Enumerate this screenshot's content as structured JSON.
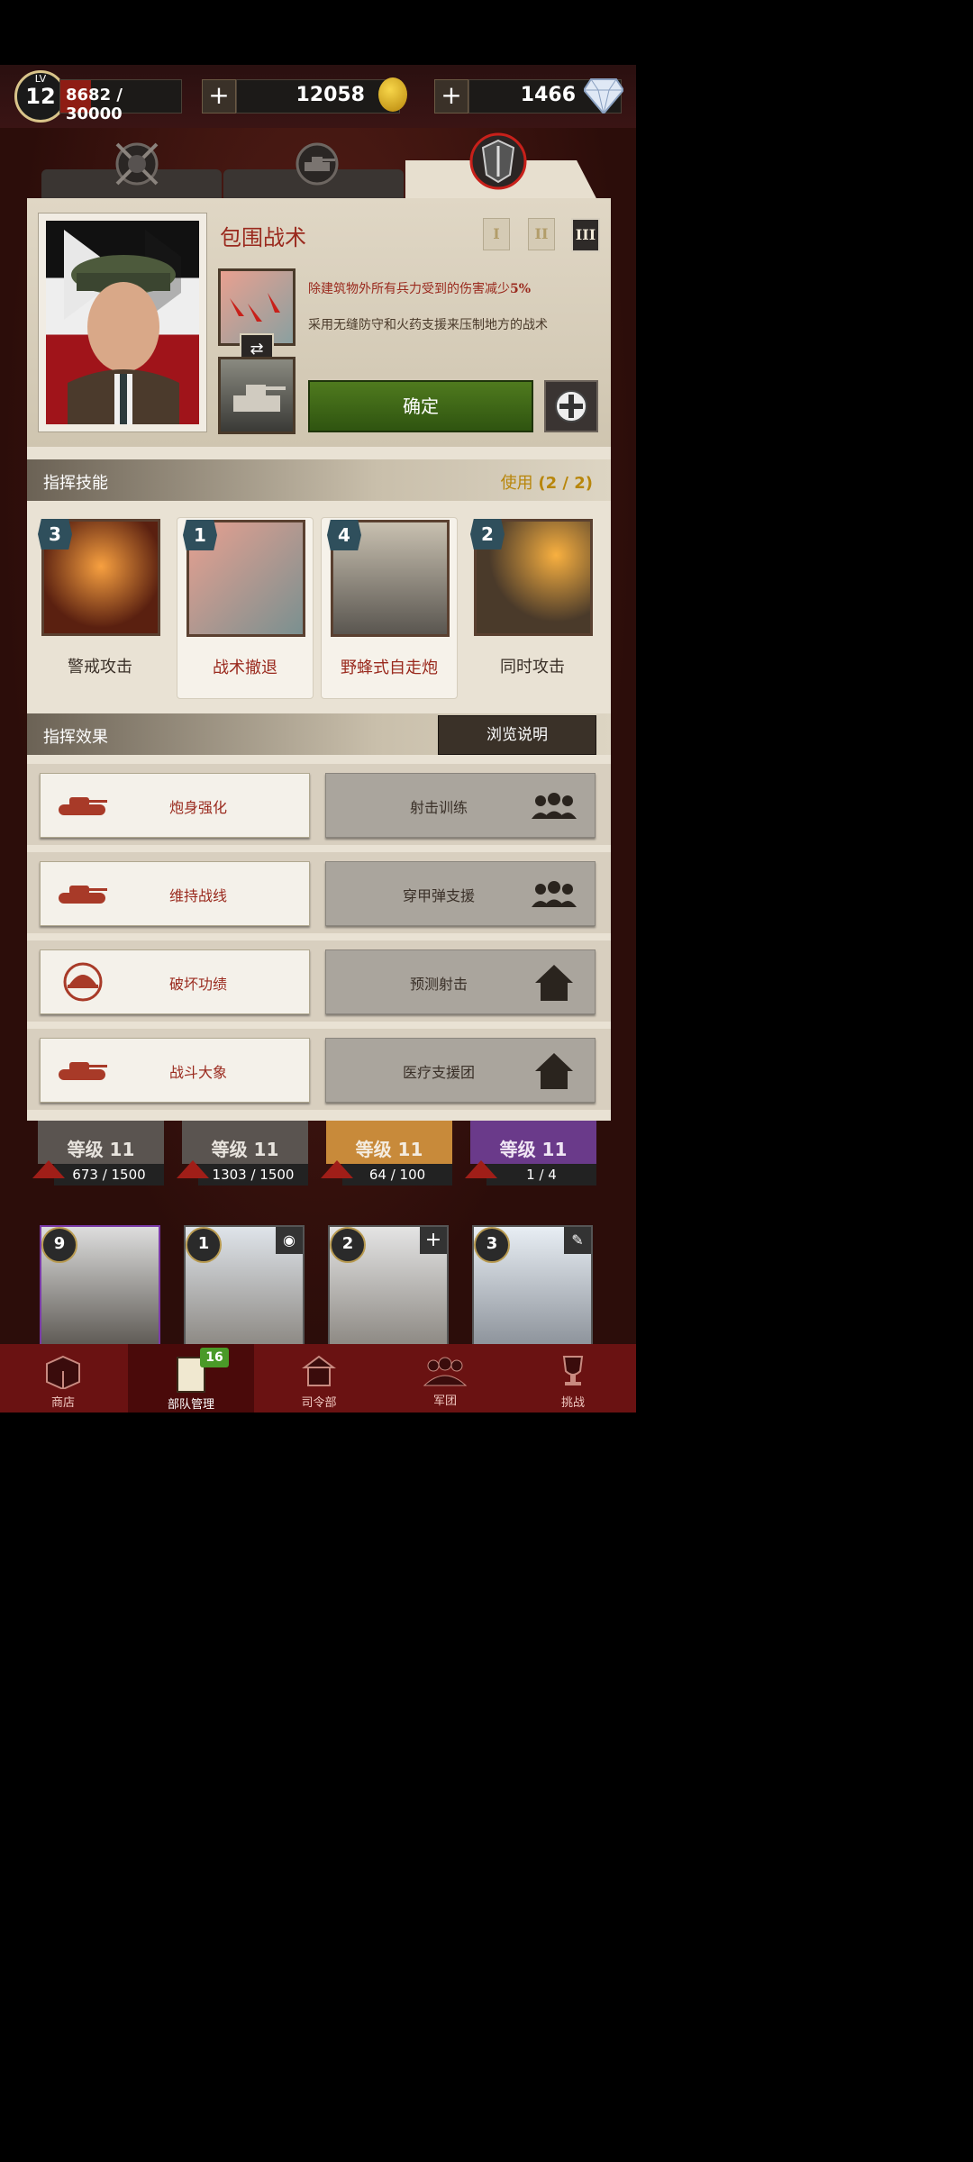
{
  "status": {
    "level_label": "LV",
    "level": "12",
    "xp": "8682 / 30000",
    "gold": "12058",
    "gems": "1466",
    "plus": "+"
  },
  "tactic": {
    "title": "包围战术",
    "tiers": [
      "I",
      "II",
      "III"
    ],
    "desc_prefix": "除建筑物外所有兵力受到的伤害减少",
    "desc_value": "5%",
    "desc2": "采用无缝防守和火药支援来压制地方的战术",
    "confirm": "确定"
  },
  "skills": {
    "header": "指挥技能",
    "usage_label": "使用",
    "usage_value": "(2 / 2)",
    "items": [
      {
        "num": "3",
        "name": "警戒攻击"
      },
      {
        "num": "1",
        "name": "战术撤退"
      },
      {
        "num": "4",
        "name": "野蜂式自走炮"
      },
      {
        "num": "2",
        "name": "同时攻击"
      }
    ]
  },
  "effects": {
    "header": "指挥效果",
    "browse": "浏览说明",
    "rows": [
      {
        "left": "炮身强化",
        "right": "射击训练",
        "left_icon": "tank-icon",
        "right_icon": "group-icon"
      },
      {
        "left": "维持战线",
        "right": "穿甲弹支援",
        "left_icon": "tank-icon",
        "right_icon": "group-icon"
      },
      {
        "left": "破坏功绩",
        "right": "预测射击",
        "left_icon": "helmet-medal-icon",
        "right_icon": "house-icon"
      },
      {
        "left": "战斗大象",
        "right": "医疗支援团",
        "left_icon": "tank-icon",
        "right_icon": "house-icon"
      }
    ]
  },
  "units": [
    {
      "level": "等级 11",
      "progress": "673 / 1500"
    },
    {
      "level": "等级 11",
      "progress": "1303 / 1500"
    },
    {
      "level": "等级 11",
      "progress": "64 / 100"
    },
    {
      "level": "等级 11",
      "progress": "1 / 4"
    }
  ],
  "bottom_cards": [
    {
      "num": "9"
    },
    {
      "num": "1"
    },
    {
      "num": "2"
    },
    {
      "num": "3"
    }
  ],
  "nav": {
    "items": [
      "商店",
      "部队管理",
      "司令部",
      "军团",
      "挑战"
    ],
    "badge": "16"
  },
  "colors": {
    "accent_red": "#9a2a1e",
    "confirm_green": "#4f7a1e",
    "gold_text": "#b8860b"
  }
}
